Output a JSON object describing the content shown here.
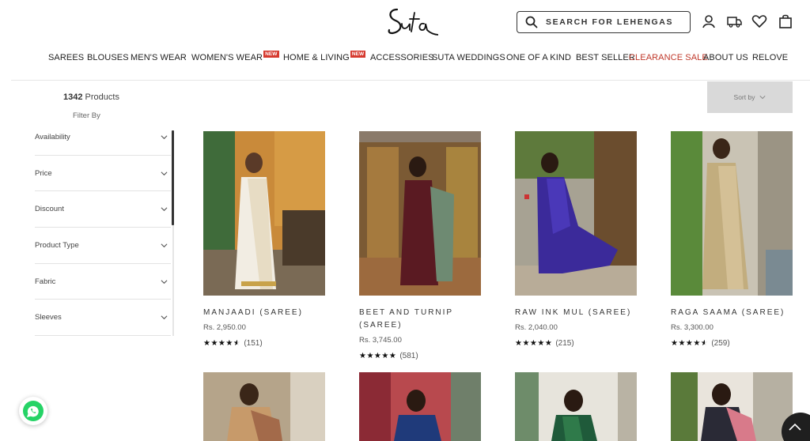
{
  "header": {
    "logo_text": "Suta",
    "search_placeholder": "SEARCH FOR LEHENGAS",
    "icons": [
      "search-icon",
      "user-icon",
      "truck-icon",
      "heart-icon",
      "bag-icon"
    ]
  },
  "nav": {
    "items": [
      {
        "label": "SAREES"
      },
      {
        "label": "BLOUSES"
      },
      {
        "label": "MEN'S WEAR"
      },
      {
        "label": "WOMEN'S WEAR",
        "badge": "NEW"
      },
      {
        "label": "HOME & LIVING",
        "badge": "NEW"
      },
      {
        "label": "ACCESSORIES"
      },
      {
        "label": "SUTA WEDDINGS"
      },
      {
        "label": "ONE OF A KIND"
      },
      {
        "label": "BEST SELLER"
      },
      {
        "label": "CLEARANCE SALE"
      },
      {
        "label": "ABOUT US"
      },
      {
        "label": "RELOVE"
      }
    ]
  },
  "listing": {
    "count": "1342",
    "count_suffix": " Products",
    "filter_by": "Filter By",
    "sort_label": "Sort by"
  },
  "filters": [
    "Availability",
    "Price",
    "Discount",
    "Product Type",
    "Fabric",
    "Sleeves"
  ],
  "products": [
    {
      "name": "MANJAADI (SAREE)",
      "price": "Rs. 2,950.00",
      "rating": 4.5,
      "reviews": "(151)"
    },
    {
      "name": "BEET AND TURNIP (SAREE)",
      "price": "Rs. 3,745.00",
      "rating": 5,
      "reviews": "(581)"
    },
    {
      "name": "RAW INK MUL (SAREE)",
      "price": "Rs. 2,040.00",
      "rating": 5,
      "reviews": "(215)"
    },
    {
      "name": "RAGA SAAMA (SAREE)",
      "price": "Rs. 3,300.00",
      "rating": 4.5,
      "reviews": "(259)"
    }
  ],
  "colors": {
    "sale": "#c0392b",
    "badge": "#d63a2f",
    "whatsapp": "#25d366"
  }
}
